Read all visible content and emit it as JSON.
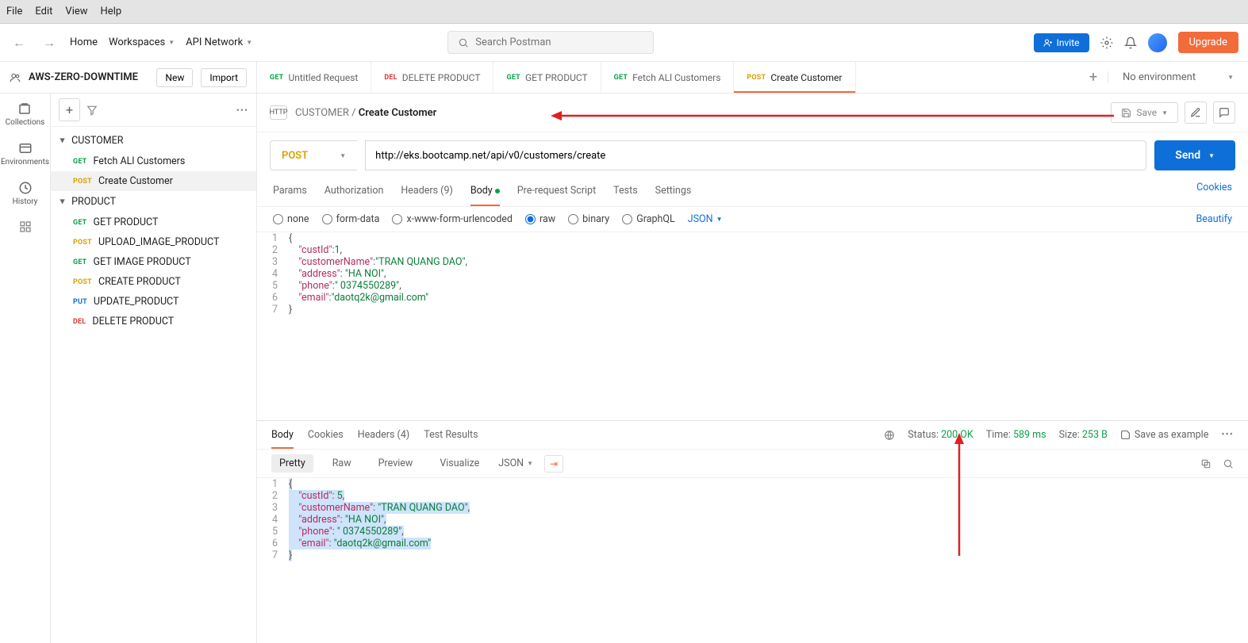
{
  "menu": {
    "file": "File",
    "edit": "Edit",
    "view": "View",
    "help": "Help"
  },
  "nav": {
    "home": "Home",
    "workspaces": "Workspaces",
    "api_network": "API Network"
  },
  "search": {
    "placeholder": "Search Postman"
  },
  "top": {
    "invite": "Invite",
    "upgrade": "Upgrade"
  },
  "workspace": {
    "name": "AWS-ZERO-DOWNTIME",
    "new": "New",
    "import": "Import"
  },
  "tabs": [
    {
      "method": "GET",
      "cls": "m-get",
      "label": "Untitled Request"
    },
    {
      "method": "DEL",
      "cls": "m-del",
      "label": "DELETE PRODUCT"
    },
    {
      "method": "GET",
      "cls": "m-get",
      "label": "GET PRODUCT"
    },
    {
      "method": "GET",
      "cls": "m-get",
      "label": "Fetch ALl Customers"
    },
    {
      "method": "POST",
      "cls": "m-post",
      "label": "Create Customer"
    }
  ],
  "env": {
    "label": "No environment"
  },
  "rail": {
    "collections": "Collections",
    "environments": "Environments",
    "history": "History"
  },
  "tree": {
    "folders": [
      {
        "name": "CUSTOMER",
        "items": [
          {
            "method": "GET",
            "cls": "m-get",
            "name": "Fetch ALl Customers"
          },
          {
            "method": "POST",
            "cls": "m-post",
            "name": "Create Customer",
            "selected": true
          }
        ]
      },
      {
        "name": "PRODUCT",
        "items": [
          {
            "method": "GET",
            "cls": "m-get",
            "name": "GET PRODUCT"
          },
          {
            "method": "POST",
            "cls": "m-post",
            "name": "UPLOAD_IMAGE_PRODUCT"
          },
          {
            "method": "GET",
            "cls": "m-get",
            "name": "GET IMAGE PRODUCT"
          },
          {
            "method": "POST",
            "cls": "m-post",
            "name": "CREATE PRODUCT"
          },
          {
            "method": "PUT",
            "cls": "m-put",
            "name": "UPDATE_PRODUCT"
          },
          {
            "method": "DEL",
            "cls": "m-del",
            "name": "DELETE PRODUCT"
          }
        ]
      }
    ]
  },
  "breadcrumb": {
    "collection": "CUSTOMER",
    "request": "Create Customer",
    "save": "Save"
  },
  "request": {
    "method": "POST",
    "url": "http://eks.bootcamp.net/api/v0/customers/create",
    "send": "Send"
  },
  "reqtabs": {
    "params": "Params",
    "auth": "Authorization",
    "headers": "Headers (9)",
    "body": "Body",
    "prereq": "Pre-request Script",
    "tests": "Tests",
    "settings": "Settings",
    "cookies": "Cookies"
  },
  "bodytypes": {
    "none": "none",
    "formdata": "form-data",
    "urlencoded": "x-www-form-urlencoded",
    "raw": "raw",
    "binary": "binary",
    "graphql": "GraphQL",
    "json": "JSON",
    "beautify": "Beautify"
  },
  "reqbody_lines": [
    "{",
    "    \"custId\":1,",
    "    \"customerName\":\"TRAN QUANG DAO\",",
    "    \"address\": \"HA NOI\",",
    "    \"phone\":\" 0374550289\",",
    "    \"email\":\"daotq2k@gmail.com\"",
    "}"
  ],
  "resptabs": {
    "body": "Body",
    "cookies": "Cookies",
    "headers": "Headers (4)",
    "tests": "Test Results"
  },
  "respinfo": {
    "status_label": "Status:",
    "status": "200 OK",
    "time_label": "Time:",
    "time": "589 ms",
    "size_label": "Size:",
    "size": "253 B",
    "save_example": "Save as example"
  },
  "respview": {
    "pretty": "Pretty",
    "raw": "Raw",
    "preview": "Preview",
    "visualize": "Visualize",
    "json": "JSON"
  },
  "respbody_lines": [
    "{",
    "    \"custId\": 5,",
    "    \"customerName\": \"TRAN QUANG DAO\",",
    "    \"address\": \"HA NOI\",",
    "    \"phone\": \" 0374550289\",",
    "    \"email\": \"daotq2k@gmail.com\"",
    "}"
  ]
}
